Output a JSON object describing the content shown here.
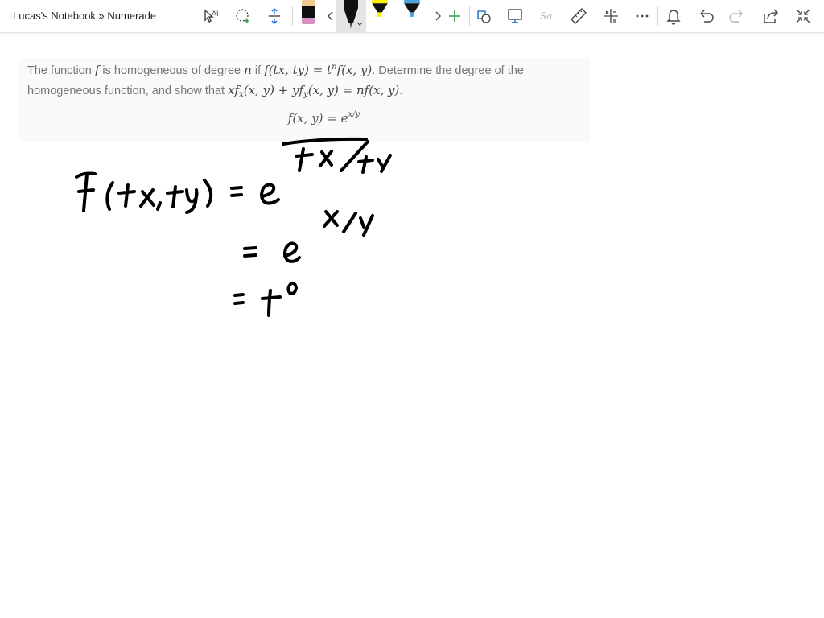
{
  "window": {
    "title": "Lucas's Notebook » Numerade"
  },
  "toolbar": {
    "pen_colors": {
      "pink_pen": "#d98fc4",
      "black_pen": "#111111",
      "yellow_highlighter": "#ffee00",
      "blue_highlighter": "#4aa3df",
      "accent": "#2f9c4a"
    }
  },
  "problem": {
    "t1": "The function ",
    "m1": "f",
    "t2": " is homogeneous of degree ",
    "m2": "n",
    "t3": " if ",
    "m3a": "f(tx, ty) = t",
    "m3b": "n",
    "m3c": "f(x, y)",
    "t4": ". Determine the degree of the homogeneous function, and show that ",
    "m4a": "xf",
    "m4b": "x",
    "m4c": "(x, y) + yf",
    "m4d": "y",
    "m4e": "(x, y) = nf(x, y)",
    "t5": ".",
    "eq_main": "f(x, y) = e",
    "eq_sup": "x/y"
  }
}
